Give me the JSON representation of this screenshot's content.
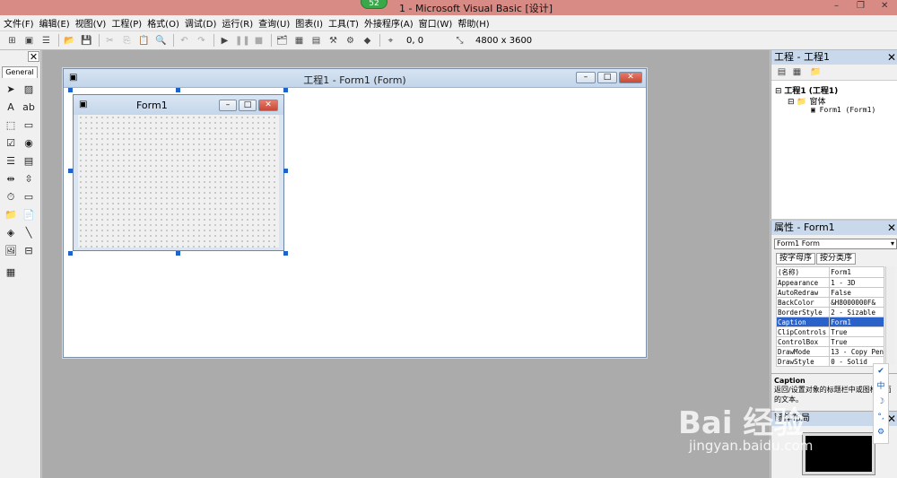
{
  "titlebar": {
    "title": "1 - Microsoft Visual Basic [设计]",
    "badge": "52",
    "min": "–",
    "restore": "❐",
    "close": "✕"
  },
  "menu": [
    "文件(F)",
    "编辑(E)",
    "视图(V)",
    "工程(P)",
    "格式(O)",
    "调试(D)",
    "运行(R)",
    "查询(U)",
    "图表(I)",
    "工具(T)",
    "外接程序(A)",
    "窗口(W)",
    "帮助(H)"
  ],
  "toolbar": {
    "position": "0, 0",
    "size": "4800 x 3600"
  },
  "toolbox": {
    "tab": "General",
    "close": "✕"
  },
  "designer": {
    "title": "工程1 - Form1 (Form)",
    "form_caption": "Form1"
  },
  "project": {
    "title": "工程 - 工程1",
    "tree": [
      "工程1 (工程1)",
      "窗体",
      "Form1 (Form1)"
    ]
  },
  "properties": {
    "title": "属性 - Form1",
    "object": "Form1 Form",
    "tab_alpha": "按字母序",
    "tab_cat": "按分类序",
    "rows": [
      [
        "(名称)",
        "Form1"
      ],
      [
        "Appearance",
        "1 - 3D"
      ],
      [
        "AutoRedraw",
        "False"
      ],
      [
        "BackColor",
        "&H8000000F&"
      ],
      [
        "BorderStyle",
        "2 - Sizable"
      ],
      [
        "Caption",
        "Form1"
      ],
      [
        "ClipControls",
        "True"
      ],
      [
        "ControlBox",
        "True"
      ],
      [
        "DrawMode",
        "13 - Copy Pen"
      ],
      [
        "DrawStyle",
        "0 - Solid"
      ]
    ],
    "selected_row": 5,
    "desc_title": "Caption",
    "desc_text": "返回/设置对象的标题栏中或图标下面的文本。"
  },
  "form_layout": {
    "title": "窗体布局"
  },
  "ime": [
    "✔",
    "中",
    "☽",
    "°,",
    "⚙"
  ],
  "watermark": {
    "brand": "Bai 经验",
    "url": "jingyan.baidu.com"
  }
}
